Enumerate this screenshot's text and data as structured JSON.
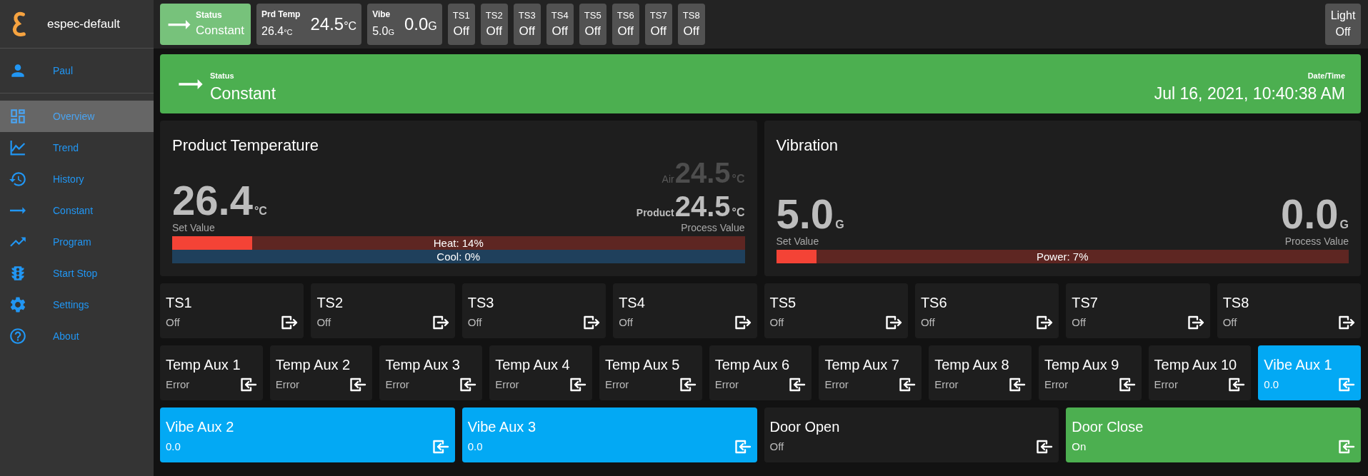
{
  "sidebar": {
    "title": "espec-default",
    "user": "Paul",
    "items": [
      {
        "label": "Overview",
        "selected": true
      },
      {
        "label": "Trend",
        "selected": false
      },
      {
        "label": "History",
        "selected": false
      },
      {
        "label": "Constant",
        "selected": false
      },
      {
        "label": "Program",
        "selected": false
      },
      {
        "label": "Start Stop",
        "selected": false
      },
      {
        "label": "Settings",
        "selected": false
      },
      {
        "label": "About",
        "selected": false
      }
    ]
  },
  "top_bar": {
    "status": {
      "label": "Status",
      "value": "Constant"
    },
    "readings": [
      {
        "label": "Prd Temp",
        "set_value": "26.4",
        "set_unit": "°C",
        "value": "24.5",
        "unit": "°C"
      },
      {
        "label": "Vibe",
        "set_value": "5.0",
        "set_unit": "G",
        "value": "0.0",
        "unit": "G"
      }
    ],
    "time_signals": [
      {
        "label": "TS1",
        "value": "Off"
      },
      {
        "label": "TS2",
        "value": "Off"
      },
      {
        "label": "TS3",
        "value": "Off"
      },
      {
        "label": "TS4",
        "value": "Off"
      },
      {
        "label": "TS5",
        "value": "Off"
      },
      {
        "label": "TS6",
        "value": "Off"
      },
      {
        "label": "TS7",
        "value": "Off"
      },
      {
        "label": "TS8",
        "value": "Off"
      }
    ],
    "light": {
      "label": "Light",
      "value": "Off"
    }
  },
  "status_banner": {
    "label": "Status",
    "value": "Constant",
    "datetime_label": "Date/Time",
    "datetime": "Jul 16, 2021, 10:40:38 AM"
  },
  "panels": [
    {
      "title": "Product Temperature",
      "set_value": "26.4",
      "set_unit": "°C",
      "set_label": "Set Value",
      "readings": [
        {
          "kind": "air",
          "label": "Air",
          "value": "24.5",
          "unit": "°C"
        },
        {
          "kind": "product",
          "label": "Product",
          "value": "24.5",
          "unit": "°C"
        }
      ],
      "process_label": "Process Value",
      "bars": [
        {
          "kind": "heat",
          "label": "Heat: 14%",
          "level": 0.14
        },
        {
          "kind": "cool",
          "label": "Cool: 0%",
          "level": 0
        }
      ]
    },
    {
      "title": "Vibration",
      "set_value": "5.0",
      "set_unit": "G",
      "set_label": "Set Value",
      "readings": [
        {
          "kind": "process",
          "value": "0.0",
          "unit": "G"
        }
      ],
      "process_label": "Process Value",
      "bars": [
        {
          "kind": "power",
          "label": "Power: 7%",
          "level": 0.07
        }
      ]
    }
  ],
  "tile_rows": [
    [
      {
        "kind": "output",
        "label": "TS1",
        "value": "Off",
        "on": false
      },
      {
        "kind": "output",
        "label": "TS2",
        "value": "Off",
        "on": false
      },
      {
        "kind": "output",
        "label": "TS3",
        "value": "Off",
        "on": false
      },
      {
        "kind": "output",
        "label": "TS4",
        "value": "Off",
        "on": false
      },
      {
        "kind": "output",
        "label": "TS5",
        "value": "Off",
        "on": false
      },
      {
        "kind": "output",
        "label": "TS6",
        "value": "Off",
        "on": false
      },
      {
        "kind": "output",
        "label": "TS7",
        "value": "Off",
        "on": false
      },
      {
        "kind": "output",
        "label": "TS8",
        "value": "Off",
        "on": false
      }
    ],
    [
      {
        "kind": "temp_aux",
        "label": "Temp Aux 1",
        "value": "Error",
        "on": false
      },
      {
        "kind": "temp_aux",
        "label": "Temp Aux 2",
        "value": "Error",
        "on": false
      },
      {
        "kind": "temp_aux",
        "label": "Temp Aux 3",
        "value": "Error",
        "on": false
      },
      {
        "kind": "temp_aux",
        "label": "Temp Aux 4",
        "value": "Error",
        "on": false
      },
      {
        "kind": "temp_aux",
        "label": "Temp Aux 5",
        "value": "Error",
        "on": false
      },
      {
        "kind": "temp_aux",
        "label": "Temp Aux 6",
        "value": "Error",
        "on": false
      },
      {
        "kind": "temp_aux",
        "label": "Temp Aux 7",
        "value": "Error",
        "on": false
      },
      {
        "kind": "temp_aux",
        "label": "Temp Aux 8",
        "value": "Error",
        "on": false
      },
      {
        "kind": "temp_aux",
        "label": "Temp Aux 9",
        "value": "Error",
        "on": false
      },
      {
        "kind": "temp_aux",
        "label": "Temp Aux 10",
        "value": "Error",
        "on": false
      },
      {
        "kind": "vibe_aux",
        "label": "Vibe Aux 1",
        "value": "0.0"
      }
    ],
    [
      {
        "kind": "vibe_aux",
        "label": "Vibe Aux 2",
        "value": "0.0"
      },
      {
        "kind": "vibe_aux",
        "label": "Vibe Aux 3",
        "value": "0.0"
      },
      {
        "kind": "door",
        "label": "Door Open",
        "value": "Off",
        "on": false
      },
      {
        "kind": "door",
        "label": "Door Close",
        "value": "On",
        "on": true
      }
    ]
  ]
}
